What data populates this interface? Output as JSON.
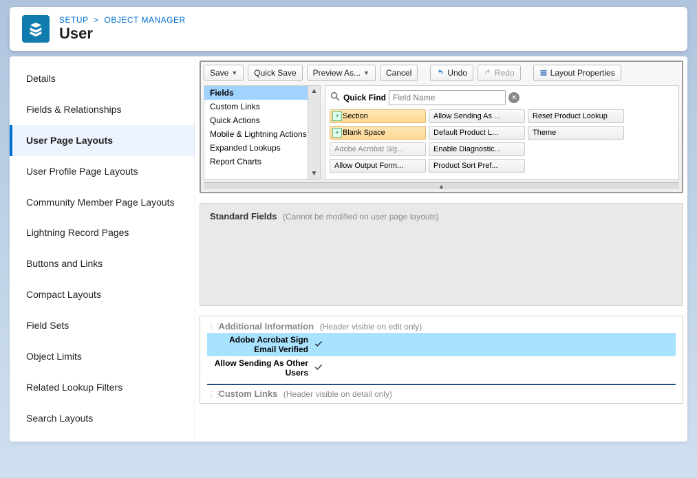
{
  "breadcrumb": {
    "root": "SETUP",
    "current": "OBJECT MANAGER"
  },
  "page_title": "User",
  "sidebar": {
    "items": [
      "Details",
      "Fields & Relationships",
      "User Page Layouts",
      "User Profile Page Layouts",
      "Community Member Page Layouts",
      "Lightning Record Pages",
      "Buttons and Links",
      "Compact Layouts",
      "Field Sets",
      "Object Limits",
      "Related Lookup Filters",
      "Search Layouts"
    ],
    "active_index": 2
  },
  "toolbar": {
    "save": "Save",
    "quick_save": "Quick Save",
    "preview_as": "Preview As...",
    "cancel": "Cancel",
    "undo": "Undo",
    "redo": "Redo",
    "layout_props": "Layout Properties"
  },
  "palette": {
    "categories": [
      "Fields",
      "Custom Links",
      "Quick Actions",
      "Mobile & Lightning Actions",
      "Expanded Lookups",
      "Report Charts"
    ],
    "selected_index": 0,
    "quick_find_label": "Quick Find",
    "quick_find_placeholder": "Field Name",
    "items": [
      {
        "label": "Section",
        "special": true
      },
      {
        "label": "Allow Sending As ..."
      },
      {
        "label": "Reset Product Lookup"
      },
      {
        "label": "Blank Space",
        "special": true
      },
      {
        "label": "Default Product L..."
      },
      {
        "label": "Theme"
      },
      {
        "label": "Adobe Acrobat Sig...",
        "muted": true
      },
      {
        "label": "Enable Diagnostic..."
      },
      {
        "label": ""
      },
      {
        "label": "Allow Output Form..."
      },
      {
        "label": "Product Sort Pref..."
      },
      {
        "label": ""
      }
    ]
  },
  "layout": {
    "standard_title": "Standard Fields",
    "standard_note": "(Cannot be modified on user page layouts)",
    "additional_title": "Additional Information",
    "additional_note": "(Header visible on edit only)",
    "fields": [
      {
        "label": "Adobe Acrobat Sign Email Verified",
        "highlight": true
      },
      {
        "label": "Allow Sending As Other Users",
        "highlight": false
      }
    ],
    "custom_links_title": "Custom Links",
    "custom_links_note": "(Header visible on detail only)"
  }
}
